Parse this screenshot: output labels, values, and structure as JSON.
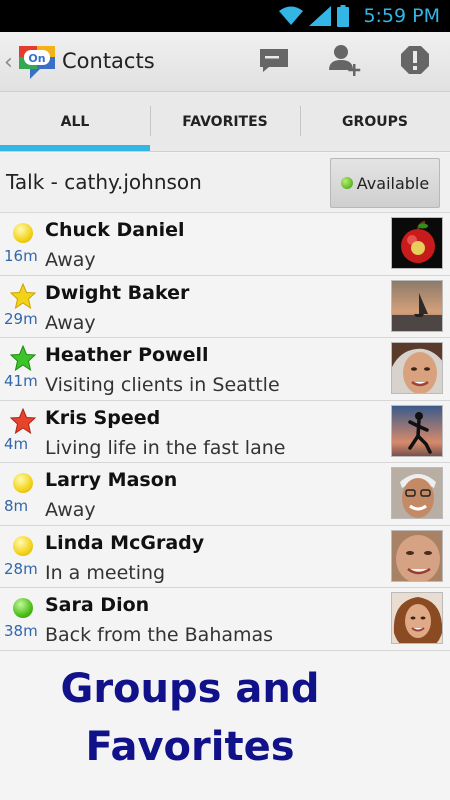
{
  "status_bar": {
    "time": "5:59 PM",
    "icons": [
      "wifi-icon",
      "signal-icon",
      "battery-icon"
    ]
  },
  "action_bar": {
    "title": "Contacts",
    "actions": [
      "compose-message-icon",
      "add-contact-icon",
      "alert-icon"
    ]
  },
  "tabs": [
    {
      "label": "ALL",
      "active": true
    },
    {
      "label": "FAVORITES",
      "active": false
    },
    {
      "label": "GROUPS",
      "active": false
    }
  ],
  "talk": {
    "label": "Talk - cathy.johnson",
    "availability": "Available",
    "availability_color": "#4cbf1a"
  },
  "contacts": [
    {
      "name": "Chuck Daniel",
      "status": "Away",
      "elapsed": "16m",
      "indicator": "yellow-dot"
    },
    {
      "name": "Dwight Baker",
      "status": "Away",
      "elapsed": "29m",
      "indicator": "yellow-star"
    },
    {
      "name": "Heather Powell",
      "status": "Visiting clients in Seattle",
      "elapsed": "41m",
      "indicator": "green-star"
    },
    {
      "name": "Kris Speed",
      "status": "Living life in the fast lane",
      "elapsed": "4m",
      "indicator": "red-star"
    },
    {
      "name": "Larry Mason",
      "status": "Away",
      "elapsed": "8m",
      "indicator": "yellow-dot"
    },
    {
      "name": "Linda McGrady",
      "status": "In a meeting",
      "elapsed": "28m",
      "indicator": "yellow-dot"
    },
    {
      "name": "Sara Dion",
      "status": "Back from the Bahamas",
      "elapsed": "38m",
      "indicator": "green-dot"
    }
  ],
  "promo": {
    "line1": "Groups and",
    "line2": "Favorites"
  },
  "colors": {
    "accent": "#33b5e5",
    "elapsed_text": "#3366aa",
    "promo_text": "#11118a"
  }
}
